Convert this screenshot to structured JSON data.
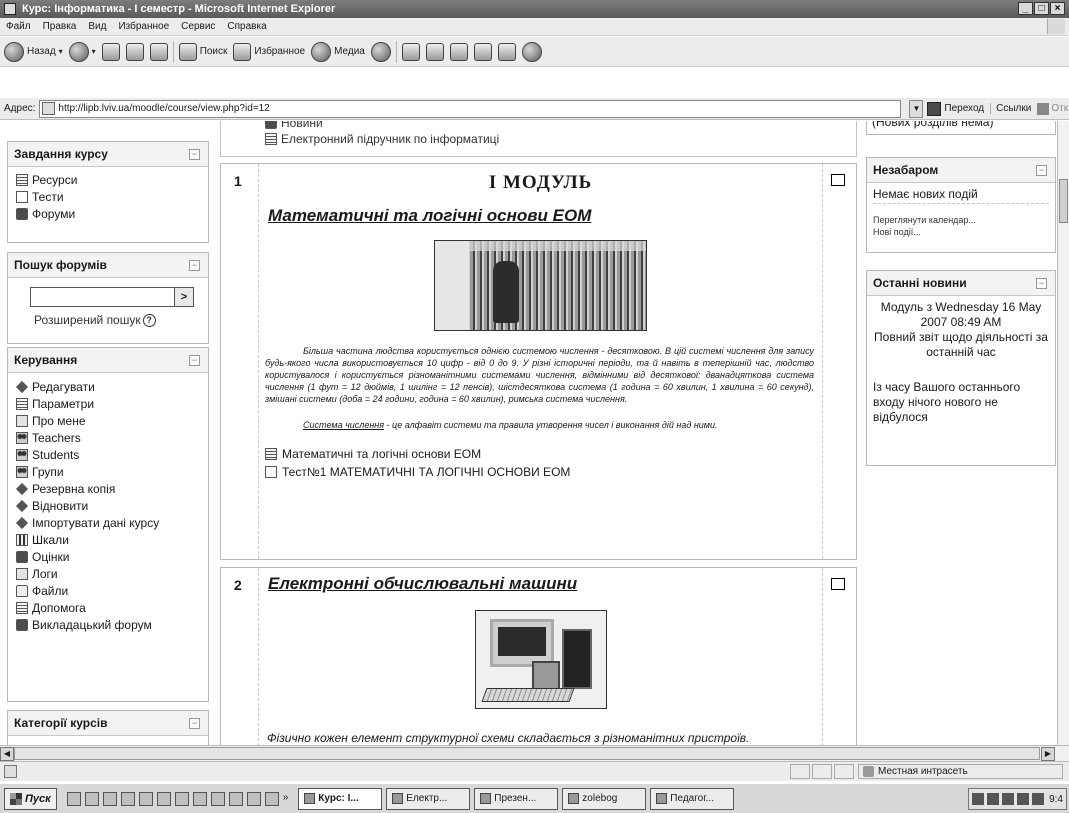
{
  "window": {
    "title": "Курс: Інформатика - I семестр - Microsoft Internet Explorer",
    "buttons": [
      "_",
      "□",
      "×"
    ]
  },
  "menu": [
    "Файл",
    "Правка",
    "Вид",
    "Избранное",
    "Сервис",
    "Справка"
  ],
  "toolbar": {
    "back": "Назад",
    "search": "Поиск",
    "favorites": "Избранное",
    "media": "Медиа"
  },
  "address": {
    "label": "Адрес:",
    "url": "http://lipb.lviv.ua/moodle/course/view.php?id=12",
    "go": "Переход",
    "links": "Ссылки",
    "extra": "Отк"
  },
  "top_box": {
    "item1": "Новини",
    "item2": "Електронний підручник по інформатиці"
  },
  "left": {
    "tasks_block": {
      "title": "Завдання курсу",
      "items": [
        {
          "label": "Ресурси",
          "icon": "document-icon"
        },
        {
          "label": "Тести",
          "icon": "checkbox-icon"
        },
        {
          "label": "Форуми",
          "icon": "forum-icon"
        }
      ]
    },
    "search_block": {
      "title": "Пошук форумів",
      "go": ">",
      "advanced": "Розширений пошук",
      "help": "?"
    },
    "admin_block": {
      "title": "Керування",
      "items": [
        {
          "label": "Редагувати",
          "icon": "edit-icon"
        },
        {
          "label": "Параметри",
          "icon": "settings-icon"
        },
        {
          "label": "Про мене",
          "icon": "profile-icon"
        },
        {
          "label": "Teachers",
          "icon": "teachers-icon"
        },
        {
          "label": "Students",
          "icon": "students-icon"
        },
        {
          "label": "Групи",
          "icon": "groups-icon"
        },
        {
          "label": "Резервна копія",
          "icon": "backup-icon"
        },
        {
          "label": "Відновити",
          "icon": "restore-icon"
        },
        {
          "label": "Імпортувати дані курсу",
          "icon": "import-icon"
        },
        {
          "label": "Шкали",
          "icon": "scales-icon"
        },
        {
          "label": "Оцінки",
          "icon": "grades-icon"
        },
        {
          "label": "Логи",
          "icon": "logs-icon"
        },
        {
          "label": "Файли",
          "icon": "folder-icon"
        },
        {
          "label": "Допомога",
          "icon": "help-doc-icon"
        },
        {
          "label": "Викладацький форум",
          "icon": "forum-icon"
        }
      ]
    },
    "categories_block": {
      "title": "Категорії курсів"
    }
  },
  "sections": [
    {
      "number": "1",
      "module_title": "I МОДУЛЬ",
      "heading": "Математичні та логічні основи ЕОМ",
      "paragraph": "Більша частина людства користується однією системою числення - десятковою. В цій системі числення для запису будь-якого числа використовується 10 цифр - від 0 до 9. У різні історичні періоди, та й навіть в теперішній час, людство користувалося і користується різноманітними системами числення, відмінними від десяткової: дванадцяткова система числення (1 фут = 12 дюймів, 1 шилінг = 12 пенсів), шістдесяткова система (1 година = 60 хвилин, 1 хвилина = 60 секунд), змішані системи (доба = 24 години, година = 60 хвилин), римська система числення.",
      "definition_term": "Система числення",
      "definition_rest": " - це алфавіт системи та правила утворення чисел і виконання дій над ними.",
      "resources": [
        {
          "label": "Математичні та логічні основи ЕОМ",
          "icon": "document-icon"
        },
        {
          "label": "Тест№1 МАТЕМАТИЧНІ ТА ЛОГІЧНІ ОСНОВИ ЕОМ",
          "icon": "checkbox-icon"
        }
      ]
    },
    {
      "number": "2",
      "heading": "Електронні обчислювальні машини",
      "footer": "Фізично кожен елемент структурної схеми складається з різноманітних пристроїв."
    }
  ],
  "right": {
    "top_text": "(Нових розділів нема)",
    "upcoming": {
      "title": "Незабаром",
      "no_events": "Немає нових подій",
      "calendar_link": "Переглянути календар...",
      "new_event_link": "Нові події..."
    },
    "news": {
      "title": "Останні новини",
      "module_line": "Модуль з Wednesday 16 May 2007 08:49 AM",
      "report": "Повний звіт щодо діяльності за останній час",
      "nothing": "Із часу Вашого останнього входу нічого нового не відбулося"
    }
  },
  "status": {
    "zone": "Местная интрасеть"
  },
  "taskbar": {
    "start": "Пуск",
    "more": "»",
    "tasks": [
      {
        "label": "Курс: І...",
        "active": true
      },
      {
        "label": "Електр...",
        "active": false
      },
      {
        "label": "Презен...",
        "active": false
      },
      {
        "label": "zolebog",
        "active": false
      },
      {
        "label": "Педагог...",
        "active": false
      }
    ],
    "clock": "9:4"
  }
}
